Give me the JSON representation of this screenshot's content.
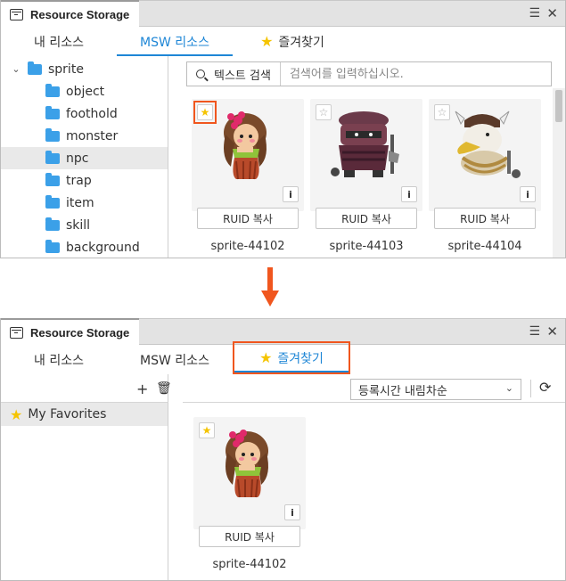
{
  "window_title": "Resource Storage",
  "window_controls": {
    "menu": "☰",
    "close": "✕"
  },
  "tabs": [
    {
      "label": "내 리소스"
    },
    {
      "label": "MSW 리소스"
    },
    {
      "label": "즐겨찾기"
    }
  ],
  "top": {
    "active_tab": "MSW 리소스",
    "tree": {
      "root": "sprite",
      "children": [
        "object",
        "foothold",
        "monster",
        "npc",
        "trap",
        "item",
        "skill",
        "background"
      ],
      "selected": "npc"
    },
    "search": {
      "type_label": "텍스트 검색",
      "placeholder": "검색어를 입력하십시오."
    },
    "cards": [
      {
        "name": "sprite-44102",
        "ruid_label": "RUID 복사",
        "favorite": true,
        "sprite": "hula-girl"
      },
      {
        "name": "sprite-44103",
        "ruid_label": "RUID 복사",
        "favorite": false,
        "sprite": "masked-bandit"
      },
      {
        "name": "sprite-44104",
        "ruid_label": "RUID 복사",
        "favorite": false,
        "sprite": "viking-bird"
      }
    ]
  },
  "bottom": {
    "active_tab": "즐겨찾기",
    "favorites_folder": "My Favorites",
    "sort": {
      "selected": "등록시간 내림차순"
    },
    "cards": [
      {
        "name": "sprite-44102",
        "ruid_label": "RUID 복사",
        "favorite": true,
        "sprite": "hula-girl"
      }
    ]
  },
  "colors": {
    "accent": "#1e86d6",
    "highlight": "#f0561e",
    "folder": "#3ba0e8",
    "star": "#f5c400"
  }
}
